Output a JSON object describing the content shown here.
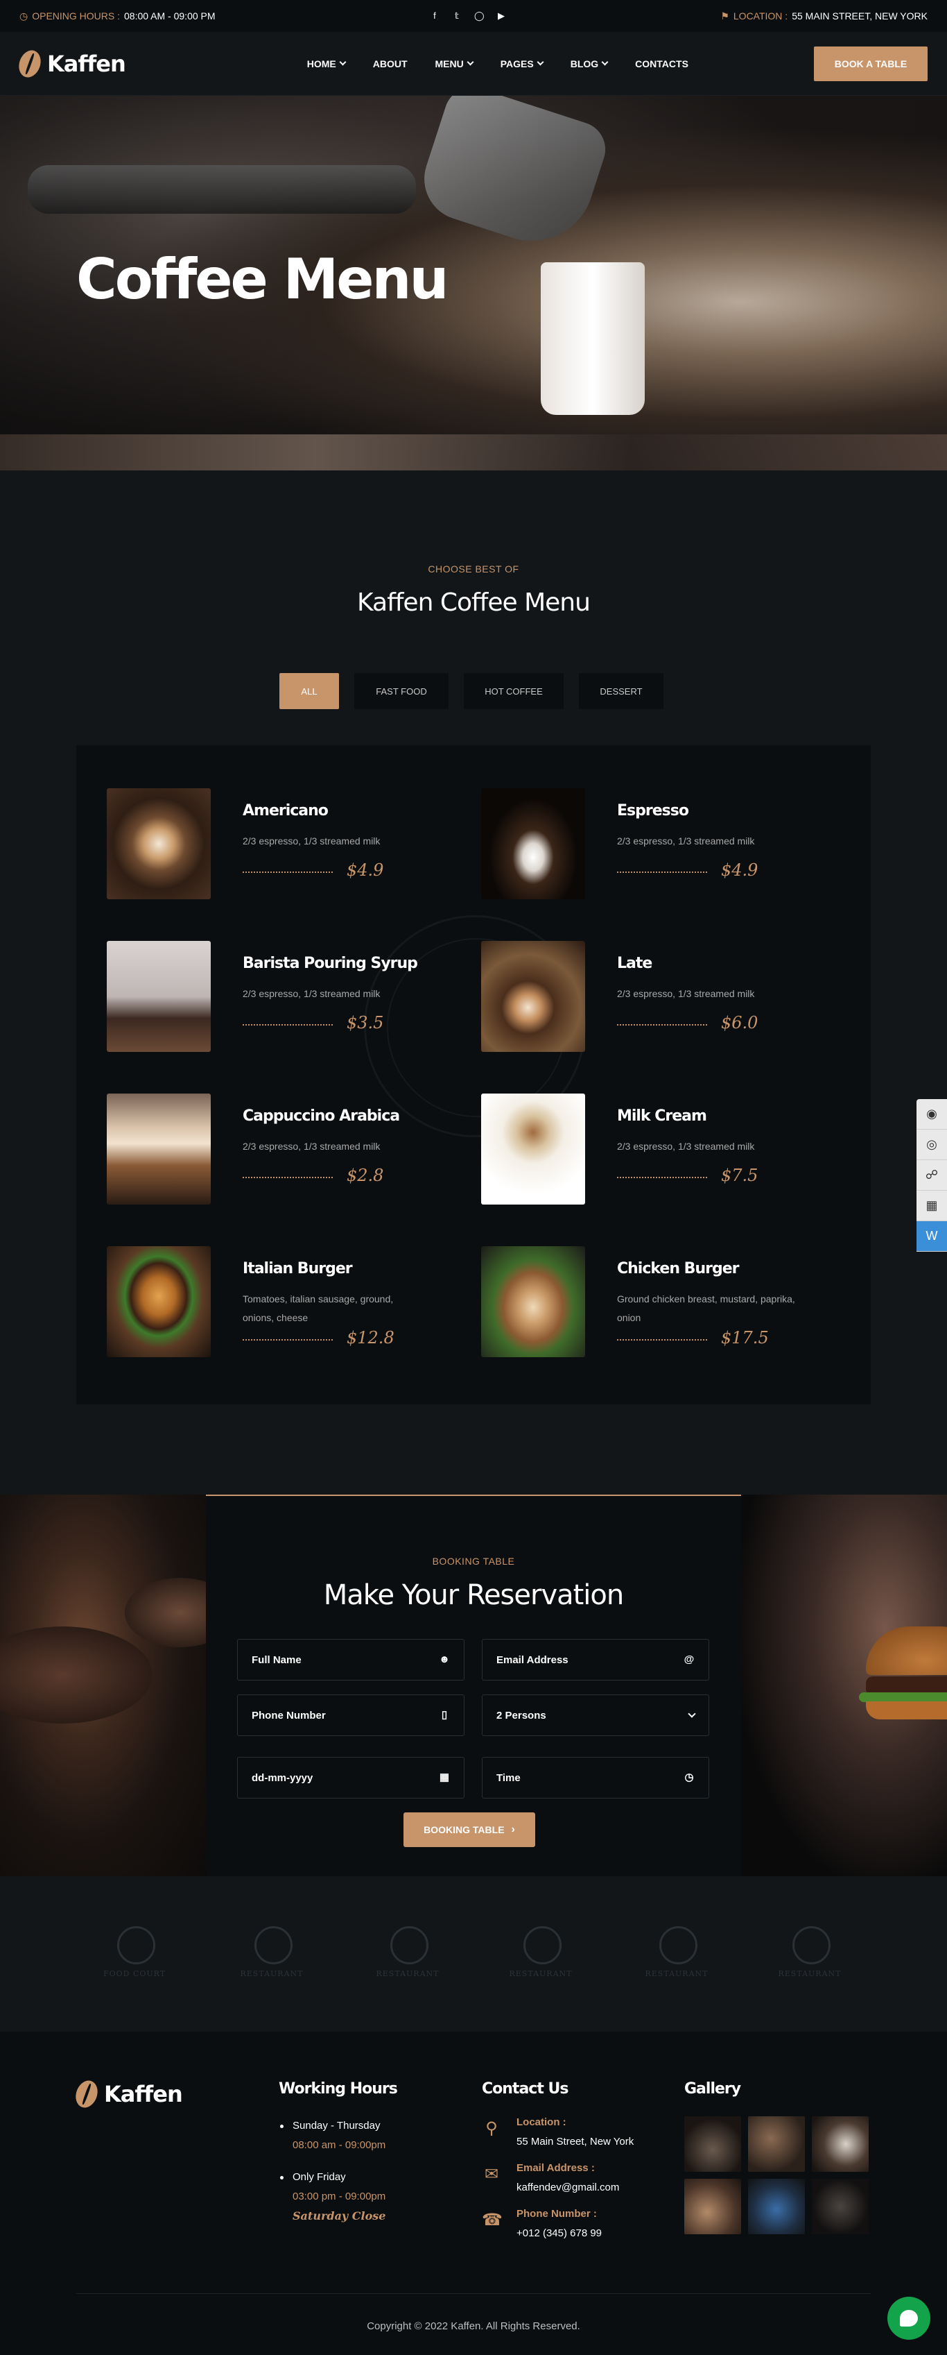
{
  "topbar": {
    "hours_label": "OPENING HOURS :",
    "hours_value": "08:00 AM - 09:00 PM",
    "location_label": "LOCATION :",
    "location_value": "55 MAIN STREET, NEW YORK",
    "social": [
      "facebook-icon",
      "twitter-icon",
      "instagram-icon",
      "youtube-icon"
    ]
  },
  "nav": {
    "logo": "Kaffen",
    "items": [
      {
        "label": "HOME",
        "dropdown": true
      },
      {
        "label": "ABOUT",
        "dropdown": false
      },
      {
        "label": "MENU",
        "dropdown": true
      },
      {
        "label": "PAGES",
        "dropdown": true
      },
      {
        "label": "BLOG",
        "dropdown": true
      },
      {
        "label": "CONTACTS",
        "dropdown": false
      }
    ],
    "cta": "BOOK A TABLE"
  },
  "hero": {
    "title": "Coffee Menu"
  },
  "menu_section": {
    "kicker": "CHOOSE BEST OF",
    "title": "Kaffen Coffee Menu",
    "filters": [
      "ALL",
      "FAST FOOD",
      "HOT COFFEE",
      "DESSERT"
    ],
    "active_filter": "ALL",
    "items": [
      {
        "name": "Americano",
        "desc": "2/3 espresso, 1/3 streamed milk",
        "price": "$4.9"
      },
      {
        "name": "Espresso",
        "desc": "2/3 espresso, 1/3 streamed milk",
        "price": "$4.9"
      },
      {
        "name": "Barista Pouring Syrup",
        "desc": "2/3 espresso, 1/3 streamed milk",
        "price": "$3.5"
      },
      {
        "name": "Late",
        "desc": "2/3 espresso, 1/3 streamed milk",
        "price": "$6.0"
      },
      {
        "name": "Cappuccino Arabica",
        "desc": "2/3 espresso, 1/3 streamed milk",
        "price": "$2.8"
      },
      {
        "name": "Milk Cream",
        "desc": "2/3 espresso, 1/3 streamed milk",
        "price": "$7.5"
      },
      {
        "name": "Italian Burger",
        "desc": "Tomatoes, italian sausage, ground, onions, cheese",
        "price": "$12.8"
      },
      {
        "name": "Chicken Burger",
        "desc": "Ground chicken breast, mustard, paprika, onion",
        "price": "$17.5"
      }
    ]
  },
  "reservation": {
    "kicker": "BOOKING TABLE",
    "title": "Make Your Reservation",
    "fields": {
      "name": "Full Name",
      "email": "Email Address",
      "phone": "Phone Number",
      "persons": "2 Persons",
      "date": "dd-mm-yyyy",
      "time": "Time"
    },
    "button": "BOOKING TABLE"
  },
  "brands": [
    "FOOD COURT",
    "RESTAURANT",
    "RESTAURANT",
    "RESTAURANT",
    "RESTAURANT",
    "RESTAURANT"
  ],
  "footer": {
    "logo": "Kaffen",
    "hours_title": "Working Hours",
    "hours": [
      {
        "days": "Sunday - Thursday",
        "time": "08:00 am - 09:00pm"
      },
      {
        "days": "Only Friday",
        "time": "03:00 pm - 09:00pm"
      }
    ],
    "closed": "Saturday Close",
    "contact_title": "Contact Us",
    "contact": [
      {
        "label": "Location :",
        "value": "55 Main Street, New York"
      },
      {
        "label": "Email Address :",
        "value": "kaffendev@gmail.com"
      },
      {
        "label": "Phone Number :",
        "value": "+012 (345) 678 99"
      }
    ],
    "gallery_title": "Gallery",
    "copyright": "Copyright © 2022 Kaffen. All Rights Reserved."
  }
}
